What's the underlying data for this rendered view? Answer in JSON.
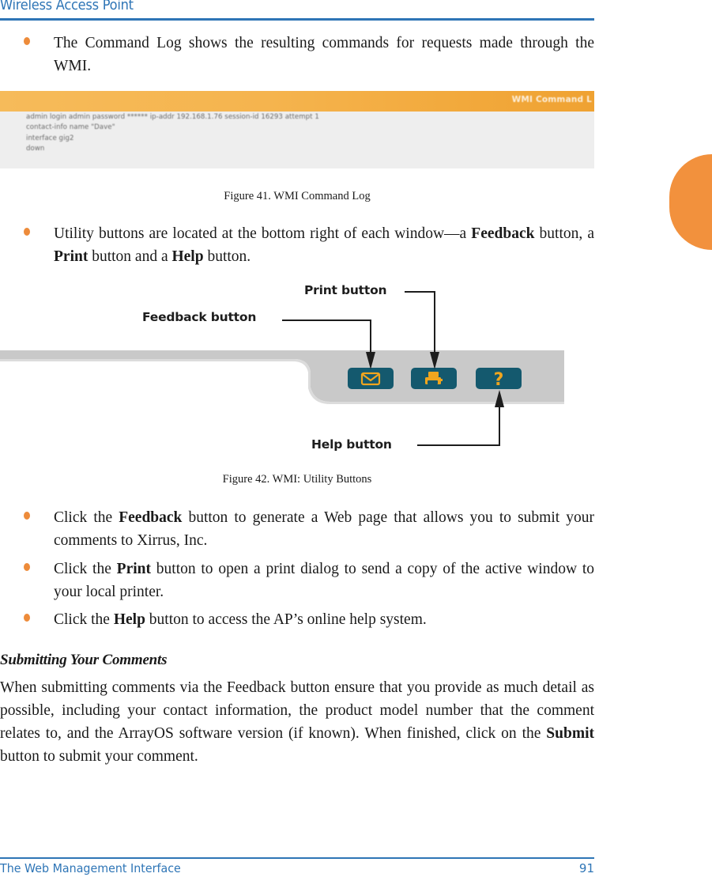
{
  "header": {
    "title": "Wireless Access Point",
    "accent_color": "#2E75B6"
  },
  "bullets_top": [
    {
      "pre": "The Command Log shows the resulting commands for requests made through the WMI.",
      "full_text": "The Command Log shows the resulting commands for requests made through the WMI."
    }
  ],
  "bullet1": {
    "text": "The Command Log shows the resulting commands for requests made through the WMI."
  },
  "figure41": {
    "titlebar_text": "WMI Command L",
    "log_lines": "admin login admin password ****** ip-addr 192.168.1.76 session-id 16293 attempt 1\ncontact-info name \"Dave\"\ninterface gig2\ndown",
    "caption": "Figure 41. WMI Command Log",
    "titlebar_color": "#f2a93c",
    "body_color": "#eeeeee"
  },
  "bullet2": {
    "part1": "Utility buttons are located at the bottom right of each window—a ",
    "b1": "Feedback",
    "part2": " button, a ",
    "b2": "Print",
    "part3": " button and a ",
    "b3": "Help",
    "part4": " button."
  },
  "figure42": {
    "caption": "Figure 42. WMI: Utility Buttons",
    "labels": {
      "feedback": "Feedback button",
      "print": "Print button",
      "help": "Help button"
    },
    "buttons": [
      {
        "name": "feedback-button",
        "icon": "envelope-icon",
        "glyph": "✉"
      },
      {
        "name": "print-button",
        "icon": "printer-icon",
        "glyph": "⎙"
      },
      {
        "name": "help-button",
        "icon": "question-mark-icon",
        "glyph": "?"
      }
    ],
    "button_color": "#14596E",
    "icon_color": "#F0A51E",
    "bar_color": "#C9C9C9"
  },
  "bullets_bottom": [
    {
      "part1": "Click the ",
      "b1": "Feedback",
      "part2": " button to generate a Web page that allows you to submit your comments to Xirrus, Inc."
    },
    {
      "part1": "Click the ",
      "b1": "Print",
      "part2": " button to open a print dialog to send a copy of the active window to your local printer."
    },
    {
      "part1": "Click the ",
      "b1": "Help",
      "part2": " button to access the AP’s online help system."
    }
  ],
  "section": {
    "heading": "Submitting Your Comments",
    "para_part1": "When submitting comments via the Feedback button ensure that you provide as much detail as possible, including your contact information, the product model number that the comment relates to, and the ArrayOS software version (if known). When finished, click on the ",
    "para_bold": "Submit",
    "para_part2": " button to submit your comment."
  },
  "footer": {
    "left": "The Web Management Interface",
    "page_number": "91"
  }
}
